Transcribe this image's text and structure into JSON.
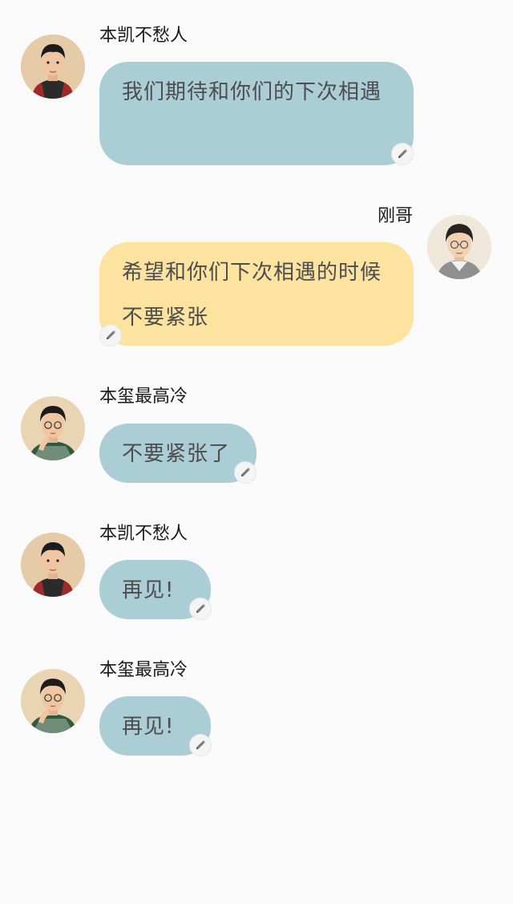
{
  "messages": [
    {
      "sender": "本凯不愁人",
      "text": "我们期待和你们的下次相遇",
      "side": "left",
      "color": "#abcdd6",
      "avatar_icon": "avatar-kai-icon"
    },
    {
      "sender": "刚哥",
      "text": "希望和你们下次相遇的时候不要紧张",
      "side": "right",
      "color": "#fde3a0",
      "avatar_icon": "avatar-gang-icon"
    },
    {
      "sender": "本玺最高冷",
      "text": "不要紧张了",
      "side": "left",
      "color": "#abcdd6",
      "avatar_icon": "avatar-xi-icon"
    },
    {
      "sender": "本凯不愁人",
      "text": "再见!",
      "side": "left",
      "color": "#abcdd6",
      "avatar_icon": "avatar-kai-icon"
    },
    {
      "sender": "本玺最高冷",
      "text": "再见!",
      "side": "left",
      "color": "#abcdd6",
      "avatar_icon": "avatar-xi-icon"
    }
  ],
  "edit_icon": "pencil-icon"
}
